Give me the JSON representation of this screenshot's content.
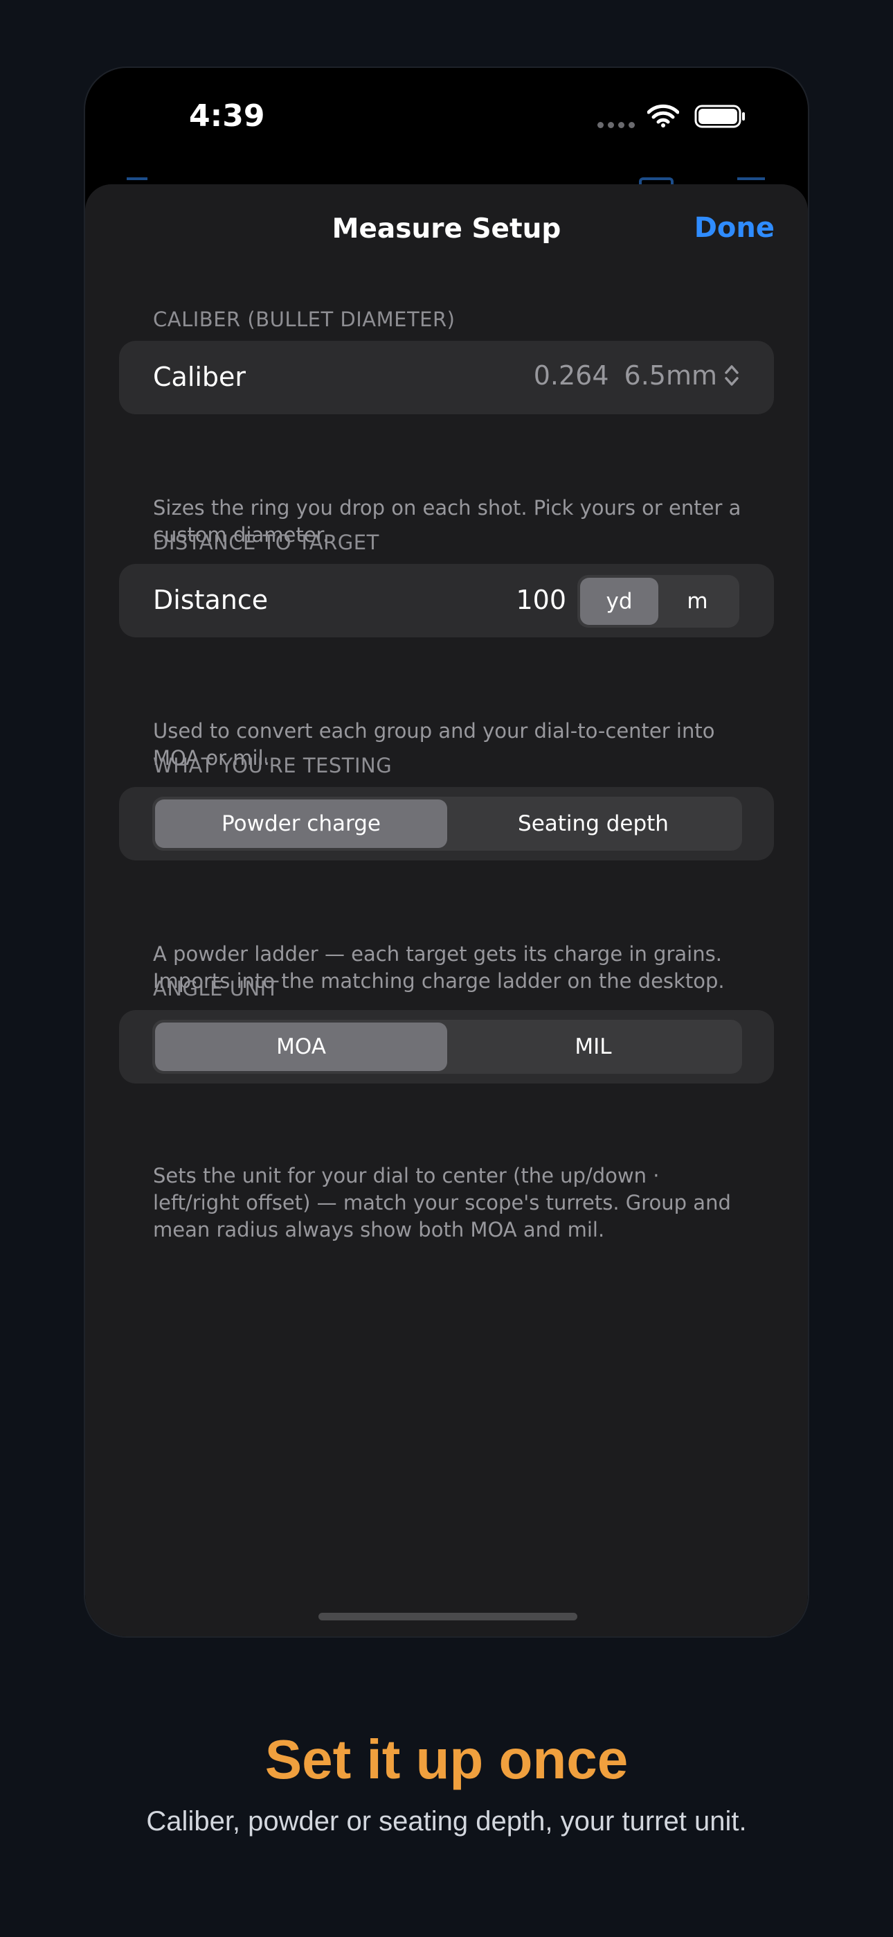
{
  "status_bar": {
    "time": "4:39"
  },
  "sheet": {
    "title": "Measure Setup",
    "done_label": "Done"
  },
  "caliber_section": {
    "header": "CALIBER (BULLET DIAMETER)",
    "label": "Caliber",
    "value_in": "0.264",
    "value_mm": "6.5mm",
    "footer": "Sizes the ring you drop on each shot. Pick yours or enter a custom diameter."
  },
  "distance_section": {
    "header": "DISTANCE TO TARGET",
    "label": "Distance",
    "value": "100",
    "units": [
      "yd",
      "m"
    ],
    "selected_unit": "yd",
    "footer": "Used to convert each group and your dial-to-center into MOA or mil."
  },
  "testing_section": {
    "header": "WHAT YOU'RE TESTING",
    "options": [
      "Powder charge",
      "Seating depth"
    ],
    "selected": "Powder charge",
    "footer": "A powder ladder — each target gets its charge in grains. Imports into the matching charge ladder on the desktop."
  },
  "angle_section": {
    "header": "ANGLE UNIT",
    "options": [
      "MOA",
      "MIL"
    ],
    "selected": "MOA",
    "footer": "Sets the unit for your dial to center (the up/down · left/right offset) — match your scope's turrets. Group and mean radius always show both MOA and mil."
  },
  "promo": {
    "title": "Set it up once",
    "subtitle": "Caliber, powder or seating depth, your turret unit."
  },
  "colors": {
    "accent": "#2f8cff",
    "promo_title": "#f0a03e",
    "background": "#0e1219",
    "sheet": "#1c1c1e",
    "group": "#2c2c2e"
  },
  "icons": [
    "wifi-icon",
    "battery-icon",
    "chevron-up-down-icon"
  ]
}
